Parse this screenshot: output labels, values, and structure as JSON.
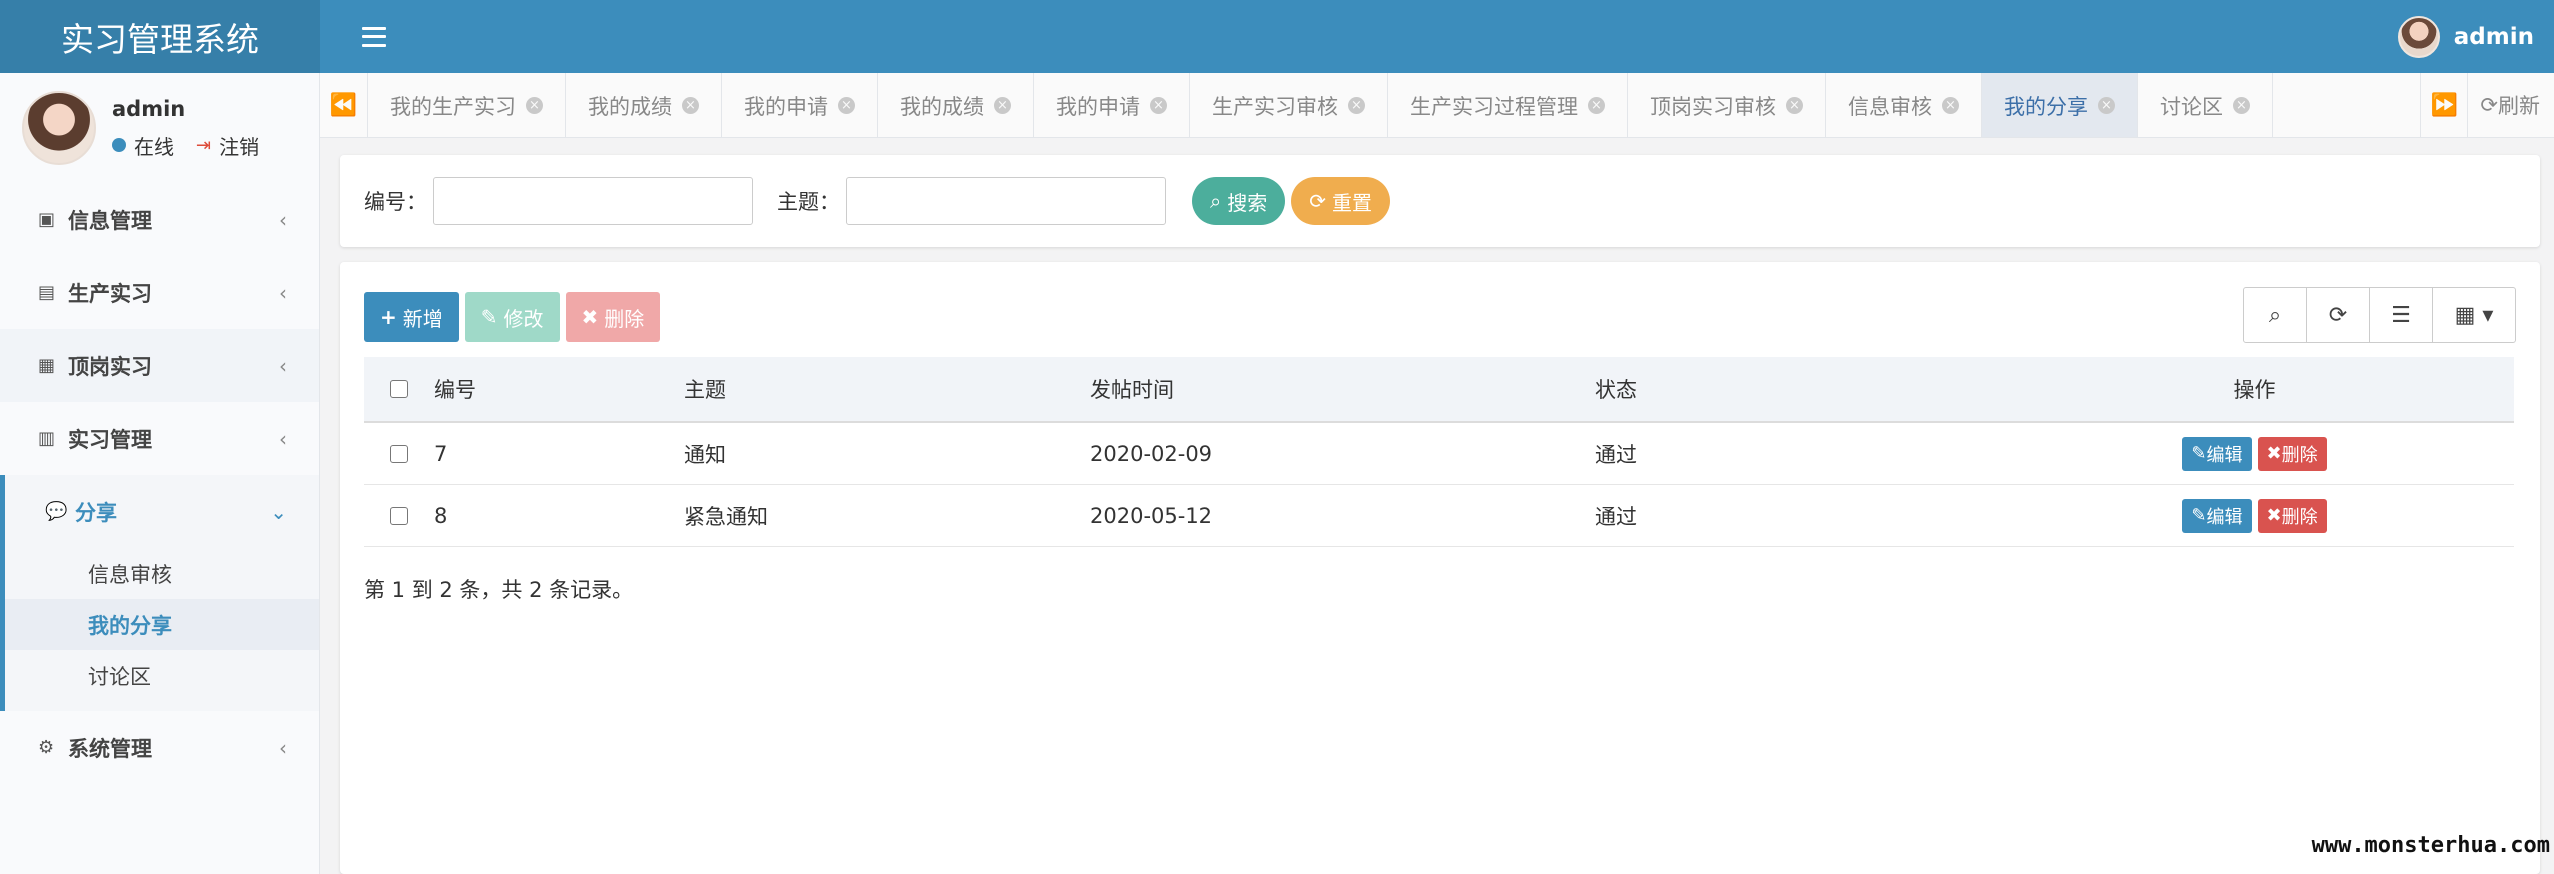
{
  "app": {
    "title": "实习管理系统"
  },
  "header": {
    "user": "admin"
  },
  "sidebar": {
    "user": {
      "name": "admin",
      "status": "在线",
      "logout": "注销"
    },
    "menu": [
      {
        "label": "信息管理",
        "icon": "id-badge-icon"
      },
      {
        "label": "生产实习",
        "icon": "user-card-icon"
      },
      {
        "label": "顶岗实习",
        "icon": "address-card-icon"
      },
      {
        "label": "实习管理",
        "icon": "vcard-icon"
      }
    ],
    "open_group": {
      "label": "分享",
      "icon": "comment-icon",
      "children": [
        "信息审核",
        "我的分享",
        "讨论区"
      ],
      "active": "我的分享"
    },
    "last": {
      "label": "系统管理",
      "icon": "gear-icon"
    }
  },
  "tabs": [
    "我的生产实习",
    "我的成绩",
    "我的申请",
    "我的成绩",
    "我的申请",
    "生产实习审核",
    "生产实习过程管理",
    "顶岗实习审核",
    "信息审核",
    "我的分享",
    "讨论区"
  ],
  "active_tab": "我的分享",
  "refresh_label": "刷新",
  "search": {
    "id_label": "编号：",
    "id_value": "",
    "subject_label": "主题：",
    "subject_value": "",
    "search_btn": "搜索",
    "reset_btn": "重置"
  },
  "toolbar": {
    "add": "新增",
    "edit": "修改",
    "delete": "删除"
  },
  "table": {
    "columns": [
      "编号",
      "主题",
      "发帖时间",
      "状态",
      "操作"
    ],
    "rows": [
      {
        "id": "7",
        "subject": "通知",
        "time": "2020-02-09",
        "status": "通过"
      },
      {
        "id": "8",
        "subject": "紧急通知",
        "time": "2020-05-12",
        "status": "通过"
      }
    ],
    "edit_label": "编辑",
    "delete_label": "删除",
    "pager_text": "第 1 到 2 条，共 2 条记录。"
  },
  "watermark": "www.monsterhua.com",
  "colors": {
    "primary": "#3c8dbc",
    "header_dark": "#367fa9",
    "success": "#4cae9c",
    "warning": "#f0ad4e",
    "danger": "#d9534f"
  }
}
